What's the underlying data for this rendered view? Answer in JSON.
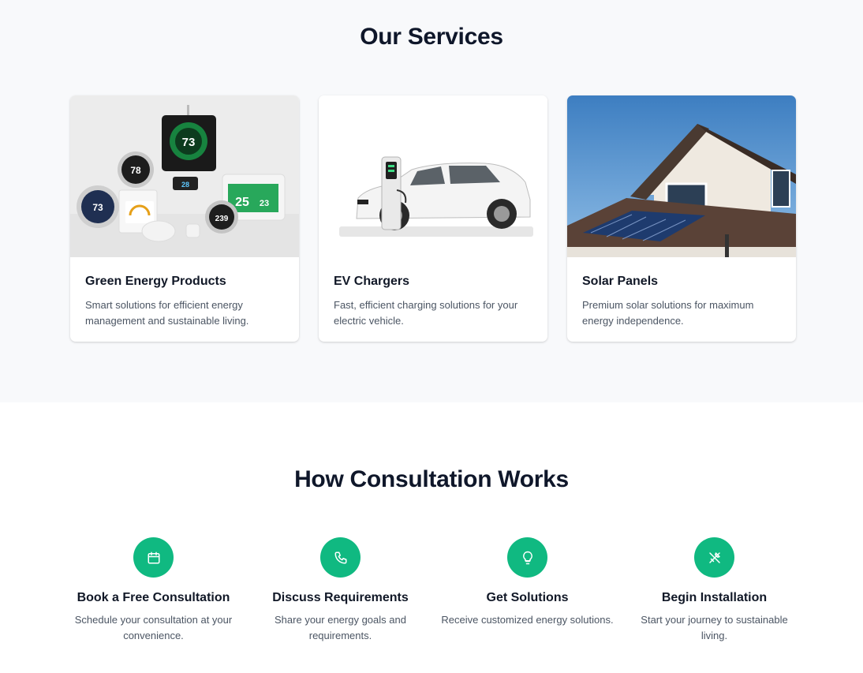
{
  "services": {
    "title": "Our Services",
    "cards": [
      {
        "title": "Green Energy Products",
        "description": "Smart solutions for efficient energy management and sustainable living.",
        "image_text": {
          "thermo_main": "73",
          "thermo_round1": "78",
          "thermo_round2": "73",
          "thermo_small": "28",
          "panel_left": "25",
          "panel_right": "23",
          "thermo_round3": "239"
        }
      },
      {
        "title": "EV Chargers",
        "description": "Fast, efficient charging solutions for your electric vehicle."
      },
      {
        "title": "Solar Panels",
        "description": "Premium solar solutions for maximum energy independence."
      }
    ]
  },
  "consultation": {
    "title": "How Consultation Works",
    "steps": [
      {
        "icon": "calendar-icon",
        "title": "Book a Free Consultation",
        "description": "Schedule your consultation at your convenience."
      },
      {
        "icon": "phone-icon",
        "title": "Discuss Requirements",
        "description": "Share your energy goals and requirements."
      },
      {
        "icon": "lightbulb-icon",
        "title": "Get Solutions",
        "description": "Receive customized energy solutions."
      },
      {
        "icon": "tools-icon",
        "title": "Begin Installation",
        "description": "Start your journey to sustainable living."
      }
    ]
  },
  "colors": {
    "accent": "#10b981",
    "heading": "#0f172a",
    "body_text": "#4b5563",
    "section_bg": "#f8f9fb"
  }
}
